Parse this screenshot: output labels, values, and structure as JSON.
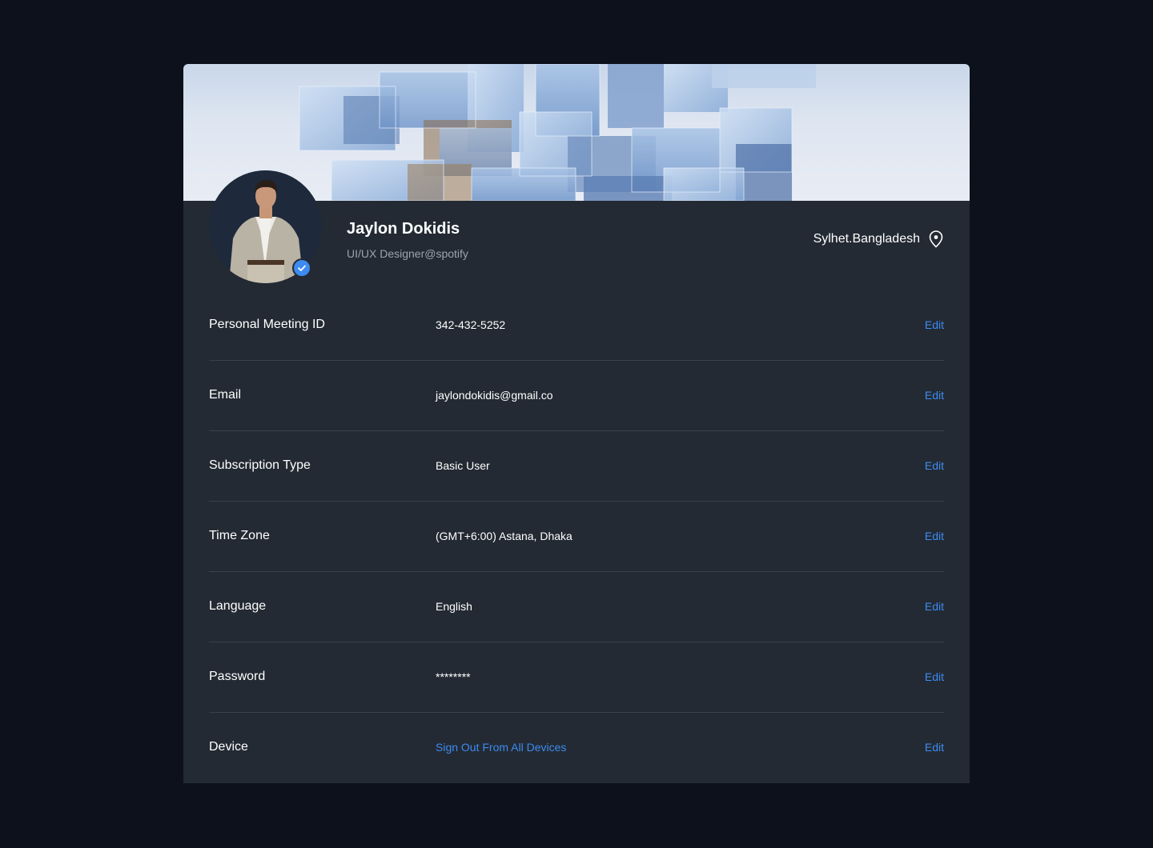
{
  "profile": {
    "name": "Jaylon Dokidis",
    "role": "UI/UX Designer@spotify",
    "location": "Sylhet.Bangladesh"
  },
  "colors": {
    "background": "#0c111b",
    "card": "#232a33",
    "accent": "#3d8bf0",
    "divider": "#39414b"
  },
  "icons": {
    "location": "map-pin-icon",
    "verified": "check-badge-icon"
  },
  "fields": [
    {
      "label": "Personal Meeting ID",
      "value": "342-432-5252",
      "action": "Edit"
    },
    {
      "label": "Email",
      "value": "jaylondokidis@gmail.co",
      "action": "Edit"
    },
    {
      "label": "Subscription Type",
      "value": "Basic User",
      "action": "Edit"
    },
    {
      "label": "Time Zone",
      "value": "(GMT+6:00) Astana, Dhaka",
      "action": "Edit"
    },
    {
      "label": "Language",
      "value": "English",
      "action": "Edit"
    },
    {
      "label": "Password",
      "value": "********",
      "action": "Edit"
    },
    {
      "label": "Device",
      "value": "Sign Out From All Devices",
      "action": "Edit"
    }
  ]
}
